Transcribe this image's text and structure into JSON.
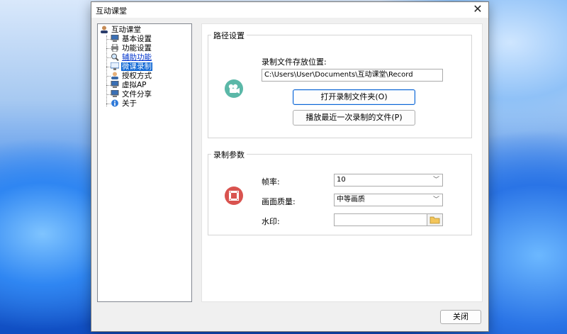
{
  "window": {
    "title": "互动课堂"
  },
  "tree": {
    "root": "互动课堂",
    "items": [
      {
        "label": "基本设置",
        "icon": "computer-icon"
      },
      {
        "label": "功能设置",
        "icon": "printer-icon"
      },
      {
        "label": "辅助功能",
        "icon": "magnifier-icon"
      },
      {
        "label": "微课录制",
        "icon": "monitor-icon"
      },
      {
        "label": "授权方式",
        "icon": "user-icon"
      },
      {
        "label": "虚拟AP",
        "icon": "computer-icon"
      },
      {
        "label": "文件分享",
        "icon": "computer-icon"
      },
      {
        "label": "关于",
        "icon": "info-icon"
      }
    ]
  },
  "path_settings": {
    "group_title": "路径设置",
    "location_label": "录制文件存放位置:",
    "location_value": "C:\\Users\\User\\Documents\\互动课堂\\Record",
    "open_folder_button": "打开录制文件夹(O)",
    "play_last_button": "播放最近一次录制的文件(P)"
  },
  "record_params": {
    "group_title": "录制参数",
    "framerate_label": "帧率:",
    "framerate_value": "10",
    "quality_label": "画面质量:",
    "quality_value": "中等画质",
    "watermark_label": "水印:",
    "watermark_value": ""
  },
  "footer": {
    "close_button": "关闭"
  },
  "colors": {
    "selection": "#0a64d4",
    "camera_icon": "#5bb8a8",
    "film_icon": "#d9534f"
  }
}
